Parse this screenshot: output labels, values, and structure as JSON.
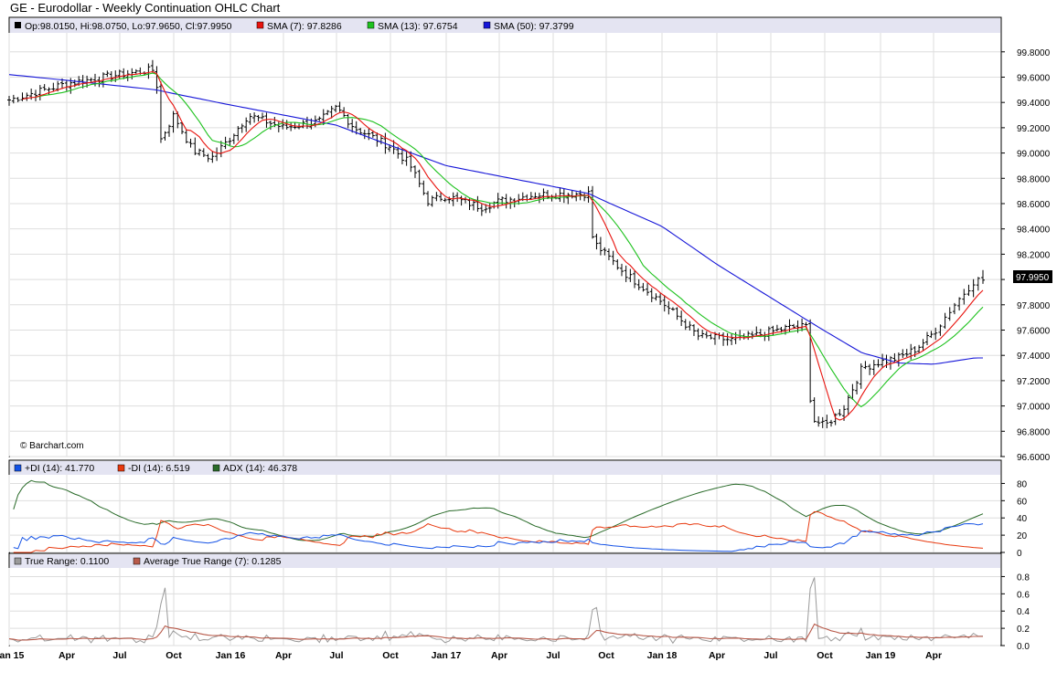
{
  "title": "GE - Eurodollar - Weekly Continuation OHLC Chart",
  "credit": "© Barchart.com",
  "colors": {
    "background": "#ffffff",
    "legend_band": "#e4e4f2",
    "grid": "#dedede",
    "ohlc": "#000000",
    "sma7": "#e8130e",
    "sma13": "#1ec21e",
    "sma50": "#1616d8",
    "plus_di": "#1452e6",
    "minus_di": "#e8390e",
    "adx": "#2a6b2a",
    "true_range": "#9a9a9a",
    "avg_true_range": "#b85a4a",
    "last_price_box": "#000000"
  },
  "x_axis_labels": [
    "Jan 15",
    "Apr",
    "Jul",
    "Oct",
    "Jan 16",
    "Apr",
    "Jul",
    "Oct",
    "Jan 17",
    "Apr",
    "Jul",
    "Oct",
    "Jan 18",
    "Apr",
    "Jul",
    "Oct",
    "Jan 19",
    "Apr"
  ],
  "price_panel": {
    "legend": {
      "ohlc": "Op:98.0150, Hi:98.0750, Lo:97.9650, Cl:97.9950",
      "sma7": "SMA (7): 97.8286",
      "sma13": "SMA (13): 97.6754",
      "sma50": "SMA (50): 97.3799"
    },
    "y_ticks": [
      "99.8000",
      "99.6000",
      "99.4000",
      "99.2000",
      "99.0000",
      "98.8000",
      "98.6000",
      "98.4000",
      "98.2000",
      "98.0000",
      "97.8000",
      "97.6000",
      "97.4000",
      "97.2000",
      "97.0000",
      "96.8000",
      "96.6000"
    ],
    "last_price": "97.9950"
  },
  "di_panel": {
    "legend": {
      "plus_di": "+DI (14): 41.770",
      "minus_di": "-DI (14): 6.519",
      "adx": "ADX (14): 46.378"
    },
    "y_ticks": [
      "80",
      "60",
      "40",
      "20",
      "0"
    ]
  },
  "tr_panel": {
    "legend": {
      "tr": "True Range: 0.1100",
      "atr": "Average True Range (7): 0.1285"
    },
    "y_ticks": [
      "0.8",
      "0.6",
      "0.4",
      "0.2",
      "0.0"
    ]
  },
  "chart_data": [
    {
      "type": "ohlc",
      "title": "GE - Eurodollar - Weekly Continuation OHLC Chart",
      "frequency": "weekly",
      "x_range": [
        "Jan 15",
        "Jun 19"
      ],
      "ylim": [
        96.6,
        99.95
      ],
      "last": {
        "open": 98.015,
        "high": 98.075,
        "low": 97.965,
        "close": 97.995
      },
      "series_legend": [
        "SMA (7): 97.8286",
        "SMA (13): 97.6754",
        "SMA (50): 97.3799"
      ],
      "approx_close_path": [
        {
          "x": "Jan 15",
          "y": 99.42
        },
        {
          "x": "Apr 15",
          "y": 99.55
        },
        {
          "x": "Jul 15",
          "y": 99.62
        },
        {
          "x": "Sep 15",
          "y": 99.66
        },
        {
          "x": "Sep 15",
          "y": 99.1
        },
        {
          "x": "Oct 15",
          "y": 99.3
        },
        {
          "x": "Nov 15",
          "y": 99.02
        },
        {
          "x": "Dec 15",
          "y": 98.96
        },
        {
          "x": "Jan 16",
          "y": 99.12
        },
        {
          "x": "Feb 16",
          "y": 99.3
        },
        {
          "x": "Apr 16",
          "y": 99.2
        },
        {
          "x": "Jun 16",
          "y": 99.25
        },
        {
          "x": "Jul 16",
          "y": 99.36
        },
        {
          "x": "Aug 16",
          "y": 99.2
        },
        {
          "x": "Oct 16",
          "y": 99.05
        },
        {
          "x": "Nov 16",
          "y": 98.92
        },
        {
          "x": "Dec 16",
          "y": 98.62
        },
        {
          "x": "Jan 17",
          "y": 98.66
        },
        {
          "x": "Mar 17",
          "y": 98.57
        },
        {
          "x": "Apr 17",
          "y": 98.62
        },
        {
          "x": "Jun 17",
          "y": 98.67
        },
        {
          "x": "Sep 17",
          "y": 98.68
        },
        {
          "x": "Sep 17",
          "y": 98.3
        },
        {
          "x": "Nov 17",
          "y": 98.05
        },
        {
          "x": "Jan 18",
          "y": 97.82
        },
        {
          "x": "Mar 18",
          "y": 97.55
        },
        {
          "x": "May 18",
          "y": 97.52
        },
        {
          "x": "Aug 18",
          "y": 97.62
        },
        {
          "x": "Sep 18",
          "y": 97.63
        },
        {
          "x": "Sep 18",
          "y": 96.9
        },
        {
          "x": "Oct 18",
          "y": 96.84
        },
        {
          "x": "Nov 18",
          "y": 96.98
        },
        {
          "x": "Dec 18",
          "y": 97.3
        },
        {
          "x": "Jan 19",
          "y": 97.35
        },
        {
          "x": "Feb 19",
          "y": 97.38
        },
        {
          "x": "Mar 19",
          "y": 97.45
        },
        {
          "x": "Apr 19",
          "y": 97.58
        },
        {
          "x": "May 19",
          "y": 97.8
        },
        {
          "x": "Jun 19",
          "y": 97.995
        }
      ],
      "sma50_path": [
        {
          "x": "Jan 15",
          "y": 99.62
        },
        {
          "x": "Sep 15",
          "y": 99.5
        },
        {
          "x": "Jan 16",
          "y": 99.38
        },
        {
          "x": "Jul 16",
          "y": 99.22
        },
        {
          "x": "Jan 17",
          "y": 98.9
        },
        {
          "x": "Sep 17",
          "y": 98.68
        },
        {
          "x": "Jan 18",
          "y": 98.42
        },
        {
          "x": "Apr 18",
          "y": 98.12
        },
        {
          "x": "Sep 18",
          "y": 97.68
        },
        {
          "x": "Dec 18",
          "y": 97.42
        },
        {
          "x": "Feb 19",
          "y": 97.34
        },
        {
          "x": "Apr 19",
          "y": 97.33
        },
        {
          "x": "Jun 19",
          "y": 97.38
        }
      ]
    },
    {
      "type": "line",
      "series": [
        {
          "name": "+DI (14)",
          "last": 41.77
        },
        {
          "name": "-DI (14)",
          "last": 6.519
        },
        {
          "name": "ADX (14)",
          "last": 46.378
        }
      ],
      "ylim": [
        0,
        90
      ]
    },
    {
      "type": "line",
      "series": [
        {
          "name": "True Range",
          "last": 0.11
        },
        {
          "name": "Average True Range (7)",
          "last": 0.1285
        }
      ],
      "ylim": [
        0,
        0.9
      ],
      "spikes": [
        {
          "x": "Sep 15",
          "y": 0.67
        },
        {
          "x": "Sep 17",
          "y": 0.44
        },
        {
          "x": "Sep 18",
          "y": 0.79
        }
      ]
    }
  ]
}
